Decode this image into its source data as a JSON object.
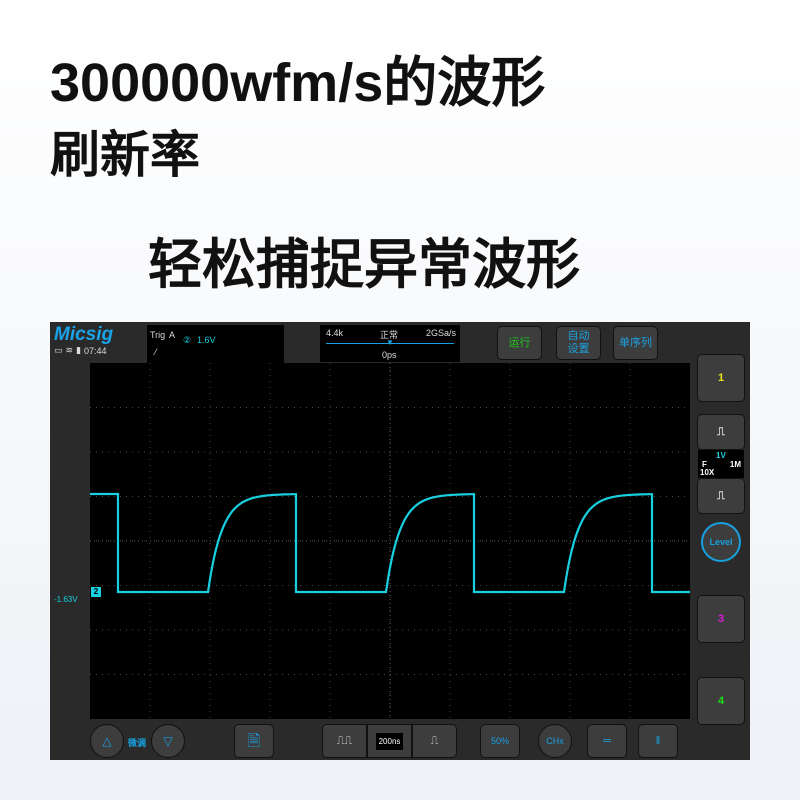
{
  "headline": {
    "line1": "300000wfm/s的波形",
    "line2": "刷新率",
    "line3": "轻松捕捉异常波形"
  },
  "scope": {
    "logo": "Micsig",
    "time": "07:44",
    "trigger": {
      "label": "Trig",
      "mode": "A",
      "channel": "②",
      "level": "1.6V"
    },
    "timebase": {
      "memory": "4.4k",
      "acq_mode": "正常",
      "sample_rate": "2GSa/s",
      "offset": "0ps"
    },
    "buttons": {
      "run": "运行",
      "auto": "自动\n设置",
      "single": "单序列"
    },
    "right": {
      "ch1": "1",
      "ch2_volts": "1V",
      "ch2_coupling": "F",
      "ch2_probe": "10X",
      "ch2_impedance": "1M",
      "level": "Level",
      "ch3": "3",
      "ch4": "4"
    },
    "ch2_offset_label": "-1.63V",
    "ch2_marker": "2",
    "bottom": {
      "fine": "微调",
      "timebase": "200ns",
      "fifty": "50%",
      "chx": "CHx"
    },
    "colors": {
      "ch1": "#e8e81a",
      "ch2": "#19d0e0",
      "ch3": "#e01ae0",
      "ch4": "#1ae01a",
      "accent": "#19a0e0",
      "run": "#1ec81e"
    }
  }
}
